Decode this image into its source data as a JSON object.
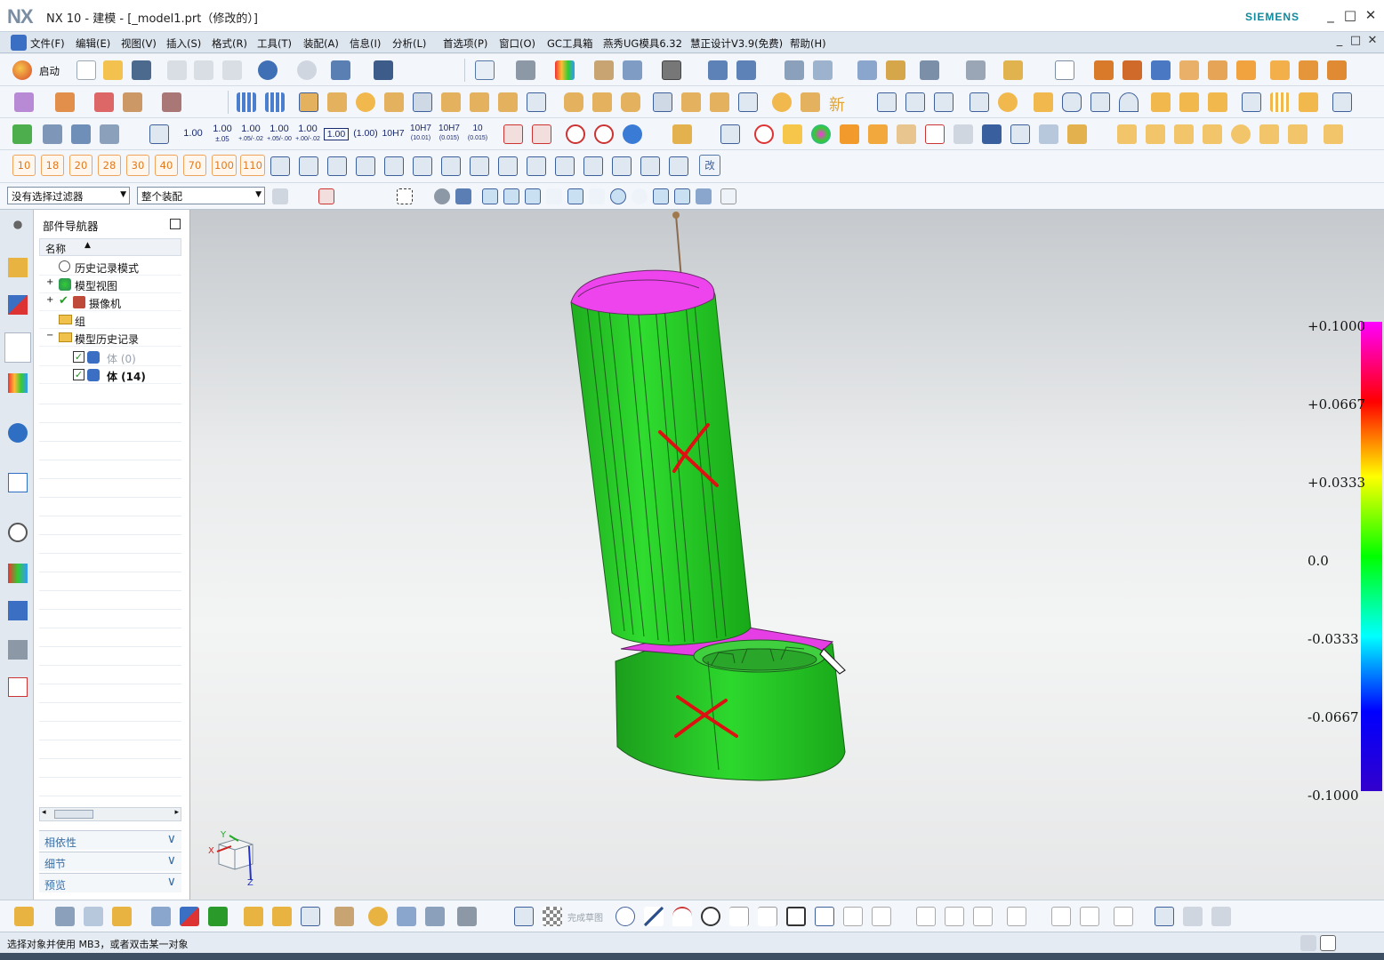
{
  "window": {
    "logo": "NX",
    "title": "NX 10 - 建模 - [_model1.prt（修改的）]",
    "brand": "SIEMENS",
    "minimize": "_",
    "maximize": "□",
    "close": "✕"
  },
  "menu": {
    "items": [
      "文件(F)",
      "编辑(E)",
      "视图(V)",
      "插入(S)",
      "格式(R)",
      "工具(T)",
      "装配(A)",
      "信息(I)",
      "分析(L)",
      "首选项(P)",
      "窗口(O)",
      "GC工具箱",
      "燕秀UG模具6.32",
      "慧正设计V3.9(免费)",
      "帮助(H)"
    ]
  },
  "toolbar1": {
    "start_label": "启动"
  },
  "toolbar3": {
    "dims": [
      "1.00",
      "1.00",
      "1.00",
      "1.00",
      "1.00",
      "1.00",
      "(1.00)",
      "10H7",
      "10H7",
      "10H7",
      "10"
    ],
    "dim_sub": [
      "",
      "±.05",
      "+.05/-.02",
      "+.05/-.00",
      "+.00/-.02",
      "",
      "",
      "",
      "(10.01)",
      "(0.015)",
      "(0.015)"
    ]
  },
  "toolbar4": {
    "numbers": [
      "10",
      "18",
      "20",
      "28",
      "30",
      "40",
      "70",
      "100",
      "110"
    ],
    "edit_char": "改"
  },
  "toolbar2": {
    "new_char": "新"
  },
  "selection": {
    "filter": "没有选择过滤器",
    "scope": "整个装配"
  },
  "navigator": {
    "title": "部件导航器",
    "column": "名称",
    "sort_icon": "▲",
    "nodes": [
      {
        "label": "历史记录模式",
        "icon": "clock-icon"
      },
      {
        "label": "模型视图",
        "icon": "views-icon"
      },
      {
        "label": "摄像机",
        "icon": "camera-icon"
      },
      {
        "label": "组",
        "icon": "folder-icon"
      },
      {
        "label": "模型历史记录",
        "icon": "folder-icon"
      },
      {
        "label": "体 (0)",
        "icon": "body-icon"
      },
      {
        "label": "体 (14)",
        "icon": "body-icon"
      }
    ],
    "panels": [
      "相依性",
      "细节",
      "预览"
    ]
  },
  "legend": {
    "labels": [
      "+0.1000",
      "+0.0667",
      "+0.0333",
      "0.0",
      "-0.0333",
      "-0.0667",
      "-0.1000"
    ]
  },
  "triad": {
    "x": "X",
    "y": "Y",
    "z": "Z"
  },
  "bottom_toolbar": {
    "finish_sketch": "完成草图"
  },
  "status": {
    "message": "选择对象并使用 MB3，或者双击某一对象"
  },
  "colors": {
    "model_green": "#22cc22",
    "model_top": "#ee44ee",
    "mark_red": "#dd1111",
    "brand": "#0f8a9d"
  }
}
